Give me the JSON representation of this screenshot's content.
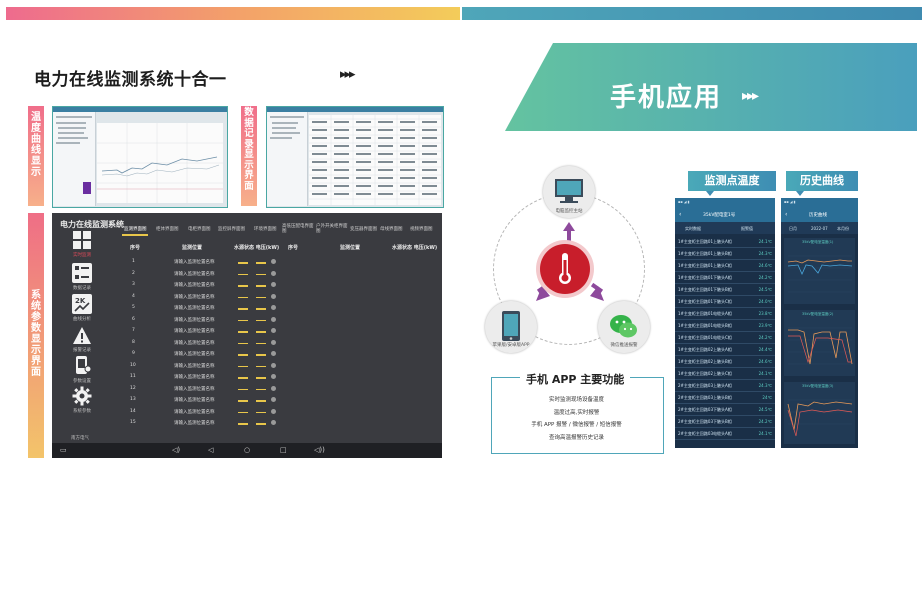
{
  "page": {
    "title": "电力在线监测系统十合一",
    "arrows": "▸▸▸",
    "banner_title": "手机应用",
    "banner_arrows": "▸▸▸"
  },
  "left": {
    "label_temp_curve": "温度曲线显示",
    "label_data_record": "数据记录显示界面",
    "label_sys_params": "系统参数显示界面",
    "panel": {
      "title": "电力在线监测系统",
      "side_menu": [
        {
          "label": "实时监测",
          "icon": "grid-icon"
        },
        {
          "label": "数据记录",
          "icon": "list-icon"
        },
        {
          "label": "曲线分析",
          "icon": "chart-icon"
        },
        {
          "label": "报警记录",
          "icon": "warning-icon"
        },
        {
          "label": "参数设置",
          "icon": "device-icon"
        },
        {
          "label": "系统参数",
          "icon": "gear-icon"
        }
      ],
      "tabs": [
        "监测界面图",
        "柜体界面图",
        "电柜界面图",
        "监控屏界面图",
        "环境界面图",
        "高低压配电界面图",
        "户外开关柜界面图",
        "变压器界面图",
        "母线界面图",
        "视频界面图"
      ],
      "headers": [
        "序号",
        "监测位置",
        "水源状态 电压(kW)",
        "序号",
        "监测位置",
        "水源状态 电压(kW)"
      ],
      "rows": [
        {
          "no": "1",
          "loc": "请输入监测位置名称"
        },
        {
          "no": "2",
          "loc": "请输入监测位置名称"
        },
        {
          "no": "3",
          "loc": "请输入监测位置名称"
        },
        {
          "no": "4",
          "loc": "请输入监测位置名称"
        },
        {
          "no": "5",
          "loc": "请输入监测位置名称"
        },
        {
          "no": "6",
          "loc": "请输入监测位置名称"
        },
        {
          "no": "7",
          "loc": "请输入监测位置名称"
        },
        {
          "no": "8",
          "loc": "请输入监测位置名称"
        },
        {
          "no": "9",
          "loc": "请输入监测位置名称"
        },
        {
          "no": "10",
          "loc": "请输入监测位置名称"
        },
        {
          "no": "11",
          "loc": "请输入监测位置名称"
        },
        {
          "no": "12",
          "loc": "请输入监测位置名称"
        },
        {
          "no": "13",
          "loc": "请输入监测位置名称"
        },
        {
          "no": "14",
          "loc": "请输入监测位置名称"
        },
        {
          "no": "15",
          "loc": "请输入监测位置名称"
        }
      ],
      "footer_left": "南方电气"
    }
  },
  "diagram": {
    "node_top": "电脑监控主站",
    "node_left": "苹果版/安卓版APP",
    "node_right": "微信推送报警",
    "func_title": "手机 APP 主要功能",
    "func_items": [
      "实时监测现场设备温度",
      "温度过高,实时报警",
      "手机 APP 报警 / 微信报警 / 短信报警",
      "查询高温报警历史记录"
    ]
  },
  "phones": {
    "temp_tag": "监测点温度",
    "hist_tag": "历史曲线",
    "temp_screen": {
      "header": "35kV配电室1号",
      "filter_left": "实时数据",
      "filter_right": "报警值",
      "rows": [
        {
          "name": "1#主变柜主回路01上触头A相",
          "val": "24.1℃"
        },
        {
          "name": "1#主变柜主回路01上触头B相",
          "val": "24.3℃"
        },
        {
          "name": "1#主变柜主回路01上触头C相",
          "val": "24.6℃"
        },
        {
          "name": "1#主变柜主回路01下触头A相",
          "val": "24.2℃"
        },
        {
          "name": "1#主变柜主回路01下触头B相",
          "val": "24.5℃"
        },
        {
          "name": "1#主变柜主回路01下触头C相",
          "val": "24.0℃"
        },
        {
          "name": "1#主变柜主回路01电缆头A相",
          "val": "23.8℃"
        },
        {
          "name": "1#主变柜主回路01电缆头B相",
          "val": "23.9℃"
        },
        {
          "name": "1#主变柜主回路01电缆头C相",
          "val": "24.2℃"
        },
        {
          "name": "1#主变柜主回路02上触头A相",
          "val": "24.4℃"
        },
        {
          "name": "1#主变柜主回路02上触头B相",
          "val": "24.6℃"
        },
        {
          "name": "1#主变柜主回路02上触头C相",
          "val": "24.1℃"
        },
        {
          "name": "2#主变柜主回路03上触头A相",
          "val": "24.3℃"
        },
        {
          "name": "2#主变柜主回路03上触头B相",
          "val": "24℃"
        },
        {
          "name": "2#主变柜主回路03下触头A相",
          "val": "24.5℃"
        },
        {
          "name": "2#主变柜主回路03下触头B相",
          "val": "24.2℃"
        },
        {
          "name": "2#主变柜主回路03电缆头A相",
          "val": "24.1℃"
        }
      ]
    },
    "hist_screen": {
      "header": "历史曲线",
      "filter_1": "日月",
      "filter_2": "2022-07",
      "filter_3": "本月份",
      "chart_titles": [
        "35kV配电室温度(1)",
        "35kV配电室温度(2)",
        "35kV配电室温度(3)"
      ]
    }
  },
  "colors": {
    "accent_teal": "#4fa6b9",
    "banner_green": "#53b6a1",
    "gradient_pink": "#ee6b8e",
    "gradient_yellow": "#f3cc5a",
    "panel_dark": "#3a3b40",
    "center_red": "#c81e2b"
  }
}
